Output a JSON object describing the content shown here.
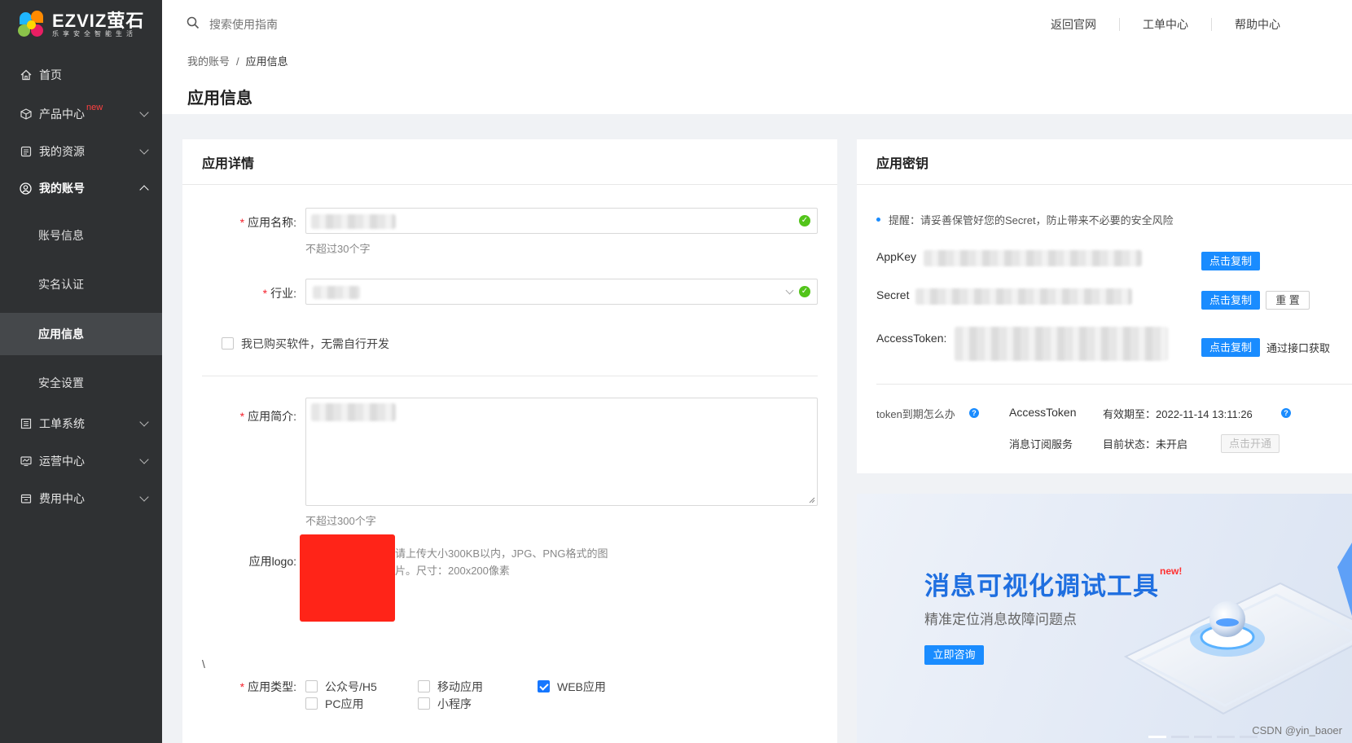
{
  "logo": {
    "brand": "EZVIZ萤石",
    "slogan": "乐享安全智能生活"
  },
  "sidebar": {
    "items": [
      {
        "label": "首页",
        "icon": "home-icon"
      },
      {
        "label": "产品中心",
        "badge": "new",
        "icon": "cube-icon"
      },
      {
        "label": "我的资源",
        "icon": "resource-icon"
      },
      {
        "label": "我的账号",
        "icon": "user-circle-icon"
      },
      {
        "label": "工单系统",
        "icon": "ticket-icon"
      },
      {
        "label": "运营中心",
        "icon": "monitor-icon"
      },
      {
        "label": "费用中心",
        "icon": "wallet-icon"
      }
    ],
    "account_sub": [
      "账号信息",
      "实名认证",
      "应用信息",
      "安全设置"
    ]
  },
  "header": {
    "search_placeholder": "搜索使用指南",
    "links": [
      "返回官网",
      "工单中心",
      "帮助中心"
    ],
    "breadcrumb": [
      "我的账号",
      "应用信息"
    ],
    "separator": "/",
    "title": "应用信息"
  },
  "details": {
    "title": "应用详情",
    "name_label": "应用名称:",
    "name_hint": "不超过30个字",
    "industry_label": "行业:",
    "purchased_label": "我已购买软件，无需自行开发",
    "intro_label": "应用简介:",
    "intro_hint": "不超过300个字",
    "logo_label": "应用logo:",
    "logo_hint_1": "请上传大小300KB以内，JPG、PNG格式的图",
    "logo_hint_2": "片。尺寸：200x200像素",
    "stray_char": "\\",
    "type_label": "应用类型:",
    "types": [
      {
        "label": "公众号/H5",
        "checked": false
      },
      {
        "label": "移动应用",
        "checked": false
      },
      {
        "label": "WEB应用",
        "checked": true
      },
      {
        "label": "PC应用",
        "checked": false
      },
      {
        "label": "小程序",
        "checked": false
      }
    ]
  },
  "keys": {
    "title": "应用密钥",
    "tip": "提醒：请妥善保管好您的Secret，防止带来不必要的安全风险",
    "appkey_label": "AppKey",
    "secret_label": "Secret",
    "token_label": "AccessToken:",
    "copy": "点击复制",
    "reset": "重 置",
    "via_api": "通过接口获取",
    "token_expire_q": "token到期怎么办",
    "token_name": "AccessToken",
    "token_valid": "有效期至：2022-11-14 13:11:26",
    "msg_service": "消息订阅服务",
    "msg_status": "目前状态：未开启",
    "msg_open": "点击开通"
  },
  "banner": {
    "title": "消息可视化调试工具",
    "badge": "new!",
    "subtitle": "精准定位消息故障问题点",
    "button": "立即咨询",
    "watermark": "CSDN @yin_baoer"
  },
  "colors": {
    "sidebar_bg": "#2f3133",
    "accent": "#1a8cff",
    "required": "#f5222d",
    "success": "#52c41a",
    "logo_mask": "#ff2418"
  }
}
